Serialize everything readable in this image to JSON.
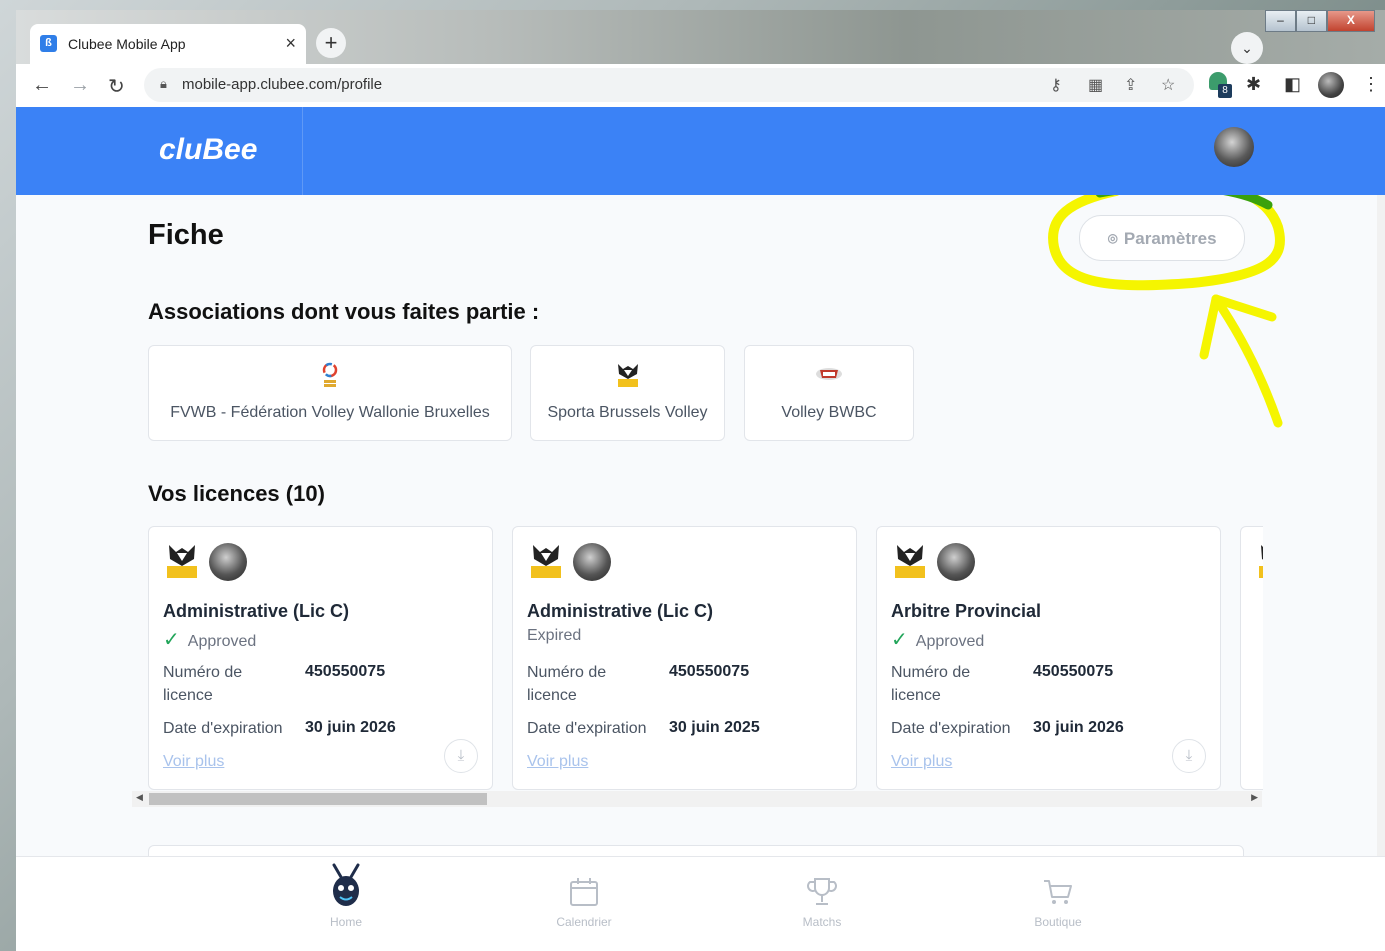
{
  "browser": {
    "tab_title": "Clubee Mobile App",
    "tab_close": "×",
    "new_tab": "+",
    "url": "mobile-app.clubee.com/profile",
    "extension_badge": "8",
    "window_controls": {
      "minimize": "–",
      "maximize": "□",
      "close": "X"
    }
  },
  "app": {
    "logo_text": "cluBee"
  },
  "page": {
    "title": "Fiche",
    "settings_button": "Paramètres",
    "associations_title": "Associations dont vous faites partie :",
    "associations": [
      {
        "name": "FVWB - Fédération Volley Wallonie Bruxelles"
      },
      {
        "name": "Sporta Brussels Volley"
      },
      {
        "name": "Volley BWBC"
      }
    ],
    "licences_title": "Vos licences (10)",
    "licences": [
      {
        "type": "Administrative (Lic C)",
        "status": "Approved",
        "approved": true,
        "number_label": "Numéro de licence",
        "number": "450550075",
        "expiry_label": "Date d'expiration",
        "expiry": "30 juin 2026",
        "more": "Voir plus"
      },
      {
        "type": "Administrative (Lic C)",
        "status": "Expired",
        "approved": false,
        "number_label": "Numéro de licence",
        "number": "450550075",
        "expiry_label": "Date d'expiration",
        "expiry": "30 juin 2025",
        "more": "Voir plus"
      },
      {
        "type": "Arbitre Provincial",
        "status": "Approved",
        "approved": true,
        "number_label": "Numéro de licence",
        "number": "450550075",
        "expiry_label": "Date d'expiration",
        "expiry": "30 juin 2026",
        "more": "Voir plus"
      }
    ]
  },
  "bottom_nav": [
    {
      "label": "Home"
    },
    {
      "label": "Calendrier"
    },
    {
      "label": "Matchs"
    },
    {
      "label": "Boutique"
    }
  ],
  "colors": {
    "primary": "#3b82f6",
    "annotation": "#f5f500",
    "approved": "#22a55a"
  }
}
